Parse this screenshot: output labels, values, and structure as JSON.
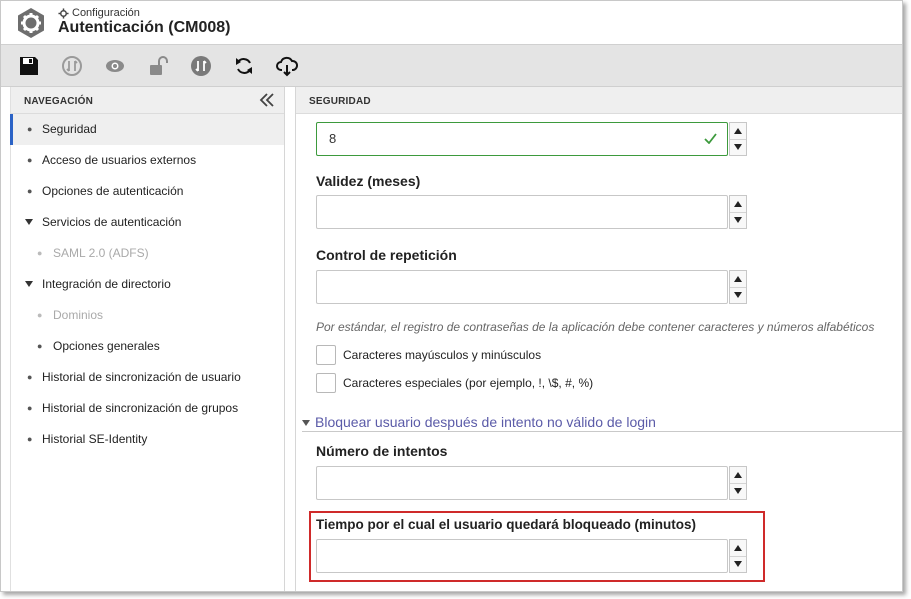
{
  "header": {
    "breadcrumb": "Configuración",
    "title": "Autenticación (CM008)"
  },
  "toolbar": {
    "buttons": [
      "save-icon",
      "sync-disabled-icon",
      "view-icon",
      "unlock-icon",
      "sync-icon",
      "refresh-icon",
      "cloud-download-icon"
    ]
  },
  "sidebar": {
    "heading": "NAVEGACIÓN",
    "items": [
      {
        "label": "Seguridad"
      },
      {
        "label": "Acceso de usuarios externos"
      },
      {
        "label": "Opciones de autenticación"
      },
      {
        "label": "Servicios de autenticación"
      },
      {
        "label": "SAML 2.0 (ADFS)"
      },
      {
        "label": "Integración de directorio"
      },
      {
        "label": "Dominios"
      },
      {
        "label": "Opciones generales"
      },
      {
        "label": "Historial de sincronización de usuario"
      },
      {
        "label": "Historial de sincronización de grupos"
      },
      {
        "label": "Historial SE-Identity"
      }
    ]
  },
  "main": {
    "heading": "SEGURIDAD",
    "first_field_value": "8",
    "validity_label": "Validez (meses)",
    "validity_value": "",
    "repeat_label": "Control de repetición",
    "repeat_value": "",
    "hint": "Por estándar, el registro de contraseñas de la aplicación debe contener caracteres y números alfabéticos",
    "checkbox_upper_lower": "Caracteres mayúsculos y minúsculos",
    "checkbox_special": "Caracteres especiales (por ejemplo, !, \\$, #, %)",
    "section_title": "Bloquear usuario después de intento no válido de login",
    "attempts_label": "Número de intentos",
    "attempts_value": "",
    "lock_time_label": "Tiempo por el cual el usuario quedará bloqueado (minutos)",
    "lock_time_value": ""
  },
  "colors": {
    "active_accent": "#2b63c6",
    "valid_border": "#3d9a3d",
    "section_link": "#5b5ba8",
    "highlight": "#cf2a2a"
  }
}
